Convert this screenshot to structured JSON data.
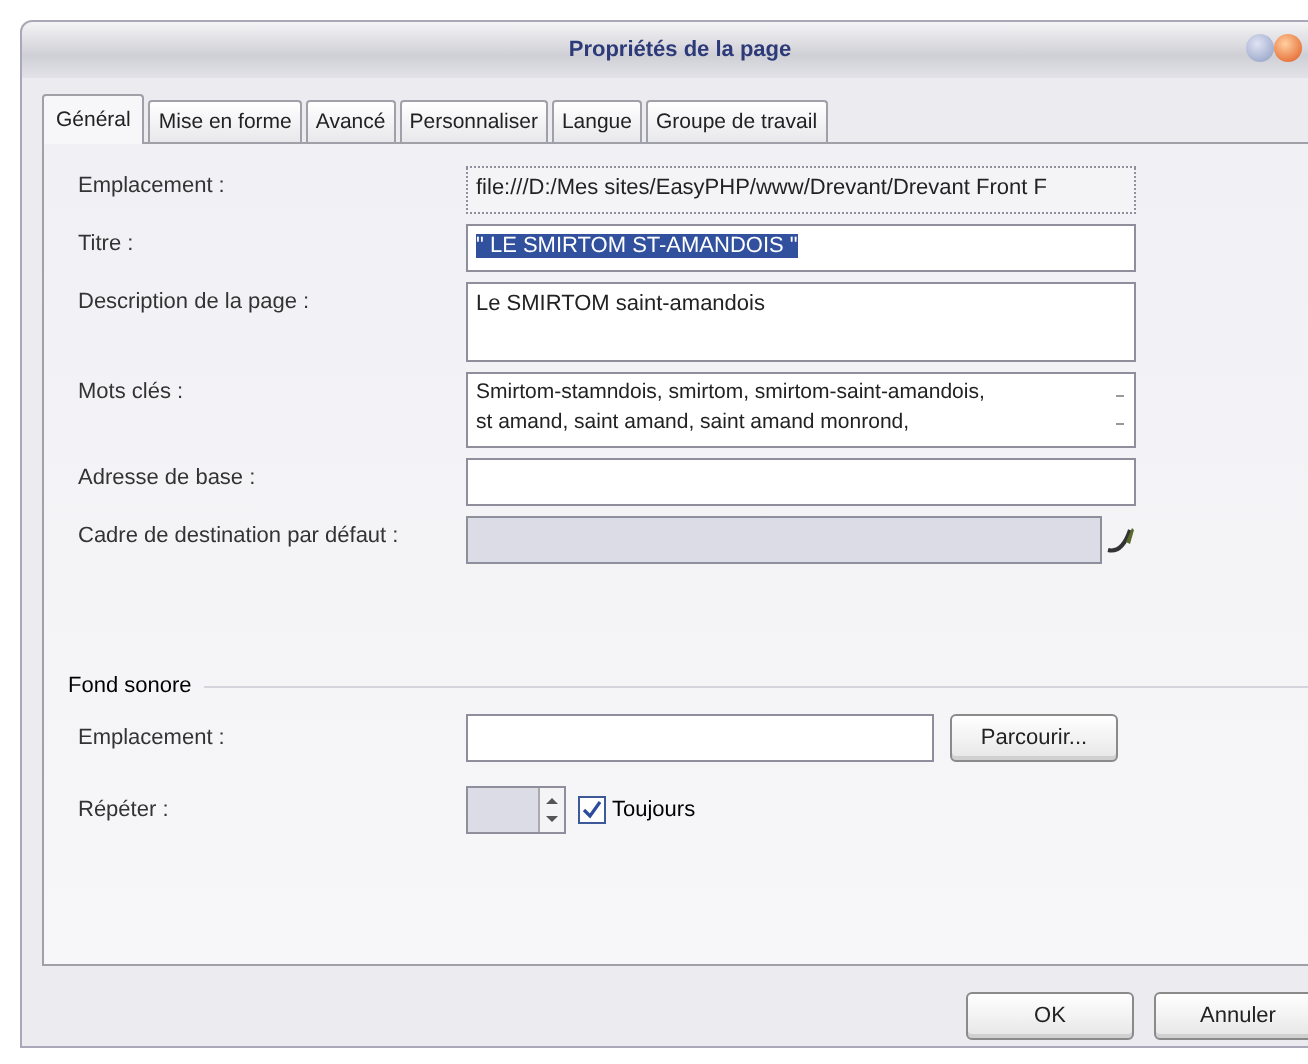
{
  "window": {
    "title": "Propriétés de la page"
  },
  "tabs": [
    {
      "label": "Général",
      "selected": true
    },
    {
      "label": "Mise en forme",
      "selected": false
    },
    {
      "label": "Avancé",
      "selected": false
    },
    {
      "label": "Personnaliser",
      "selected": false
    },
    {
      "label": "Langue",
      "selected": false
    },
    {
      "label": "Groupe de travail",
      "selected": false
    }
  ],
  "fields": [
    {
      "kind": "readonly",
      "label": "Emplacement :",
      "value": "file:///D:/Mes sites/EasyPHP/www/Drevant/Drevant Front F"
    },
    {
      "kind": "text",
      "label": "Titre :",
      "value": "\" LE SMIRTOM ST-AMANDOIS \"",
      "highlighted": true
    },
    {
      "kind": "textarea",
      "label": "Description de la page :",
      "value": "Le SMIRTOM saint-amandois"
    },
    {
      "kind": "list",
      "label": "Mots clés :",
      "lines": [
        "Smirtom-stamndois, smirtom, smirtom-saint-amandois,",
        "st amand, saint amand, saint amand monrond,"
      ]
    },
    {
      "kind": "text",
      "label": "Adresse de base :"
    },
    {
      "kind": "picker",
      "label": "Cadre de destination par défaut :",
      "disabled": true
    }
  ],
  "sound": {
    "title": "Fond sonore",
    "location_label": "Emplacement :",
    "browse": "Parcourir...",
    "repeat_label": "Répéter :",
    "always": {
      "label": "Toujours",
      "checked": true
    }
  },
  "buttons": [
    "OK",
    "Annuler"
  ]
}
